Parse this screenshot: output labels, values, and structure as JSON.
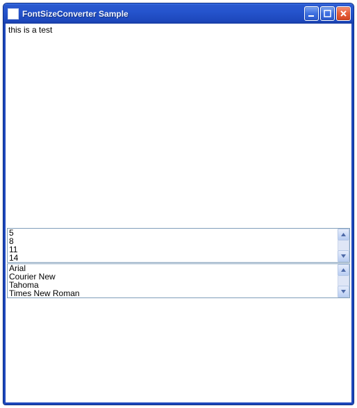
{
  "window": {
    "title": "FontSizeConverter Sample"
  },
  "content": {
    "text": "this is a test"
  },
  "list_sizes": {
    "items": [
      "5",
      "8",
      "11",
      "14"
    ]
  },
  "list_fonts": {
    "items": [
      "Arial",
      "Courier New",
      "Tahoma",
      "Times New Roman"
    ]
  }
}
